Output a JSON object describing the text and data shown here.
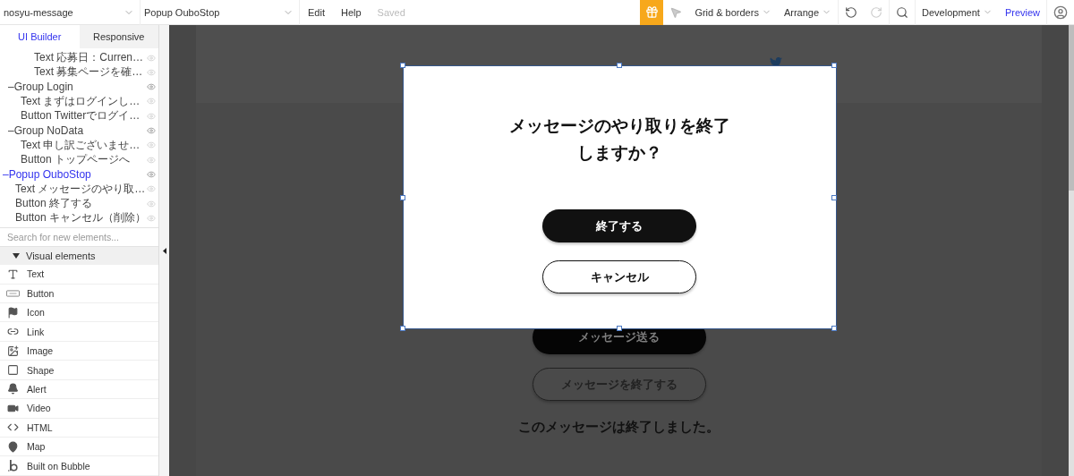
{
  "toolbar": {
    "app_select": "nosyu-message",
    "page_select": "Popup OuboStop",
    "menu": [
      "Edit",
      "Help"
    ],
    "save_status": "Saved",
    "grid_menu": "Grid & borders",
    "arrange_menu": "Arrange",
    "redo_disabled": true,
    "mode_select": "Development",
    "preview": "Preview"
  },
  "sidebar": {
    "tabs": [
      {
        "label": "UI Builder",
        "selected": true
      },
      {
        "label": "Responsive",
        "selected": false
      }
    ],
    "tree": [
      {
        "kind": "deep-leaf",
        "label": "Text 応募日：Curren…",
        "selected": false
      },
      {
        "kind": "deep-leaf",
        "label": "Text 募集ページを確…",
        "selected": false
      },
      {
        "kind": "inner-group",
        "toggle": "–",
        "label": "Group Login",
        "selected": false,
        "children": [
          {
            "label": "Text まずはログインし…",
            "selected": false
          },
          {
            "label": "Button Twitterでログイ…",
            "selected": false
          }
        ]
      },
      {
        "kind": "inner-group",
        "toggle": "–",
        "label": "Group NoData",
        "selected": false,
        "children": [
          {
            "label": "Text 申し訳ございませ…",
            "selected": false
          },
          {
            "label": "Button トップページへ",
            "selected": false
          }
        ]
      },
      {
        "kind": "root-group",
        "toggle": "–",
        "label": "Popup OuboStop",
        "selected": true,
        "children": [
          {
            "label": "Text メッセージのやり取…",
            "selected": false
          },
          {
            "label": "Button 終了する",
            "selected": false
          },
          {
            "label": "Button キャンセル（削除）",
            "selected": false
          }
        ]
      }
    ],
    "search": {
      "placeholder": "Search for new elements..."
    },
    "section": {
      "label": "Visual elements",
      "expanded": true
    },
    "palette": [
      {
        "kind": "text",
        "label": "Text"
      },
      {
        "kind": "button",
        "label": "Button"
      },
      {
        "kind": "icon",
        "label": "Icon"
      },
      {
        "kind": "link",
        "label": "Link"
      },
      {
        "kind": "image",
        "label": "Image"
      },
      {
        "kind": "shape",
        "label": "Shape"
      },
      {
        "kind": "alert",
        "label": "Alert"
      },
      {
        "kind": "video",
        "label": "Video"
      },
      {
        "kind": "html",
        "label": "HTML"
      },
      {
        "kind": "map",
        "label": "Map"
      },
      {
        "kind": "bubble",
        "label": "Built on Bubble"
      }
    ]
  },
  "canvas": {
    "buttons": [
      {
        "kind": "filled",
        "label": "メッセージ送る"
      },
      {
        "kind": "outline",
        "label": "メッセージを終了する"
      }
    ],
    "message": "このメッセージは終了しました。"
  },
  "popup": {
    "title_lines": [
      "メッセージのやり取りを終了",
      "しますか？"
    ],
    "buttons": [
      {
        "kind": "filled",
        "label": "終了する"
      },
      {
        "kind": "outline",
        "label": "キャンセル"
      }
    ]
  }
}
